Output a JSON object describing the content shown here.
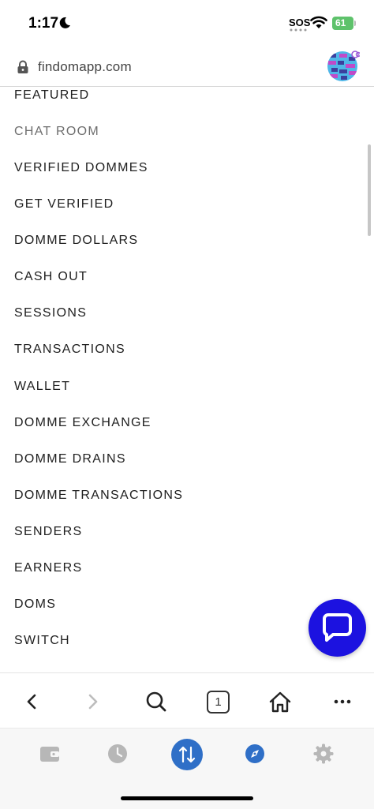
{
  "status_bar": {
    "time": "1:17",
    "sos": "SOS",
    "battery": "61"
  },
  "address_bar": {
    "url": "findomapp.com"
  },
  "menu": {
    "items": [
      "FEATURED",
      "CHAT ROOM",
      "VERIFIED DOMMES",
      "GET VERIFIED",
      "DOMME DOLLARS",
      "CASH OUT",
      "SESSIONS",
      "TRANSACTIONS",
      "WALLET",
      "DOMME EXCHANGE",
      "DOMME DRAINS",
      "DOMME TRANSACTIONS",
      "SENDERS",
      "EARNERS",
      "DOMS",
      "SWITCH"
    ]
  },
  "browser_toolbar": {
    "tab_count": "1"
  },
  "colors": {
    "chat_fab": "#1c12e0",
    "nav_active": "#2f6fc7",
    "battery": "#5ec26b"
  },
  "icons": {
    "toolbar": [
      "back-icon",
      "forward-icon",
      "search-icon",
      "tabs-icon",
      "home-icon",
      "more-icon"
    ],
    "bottom_nav": [
      "wallet-icon",
      "clock-icon",
      "transfer-icon",
      "compass-icon",
      "gear-icon"
    ]
  }
}
